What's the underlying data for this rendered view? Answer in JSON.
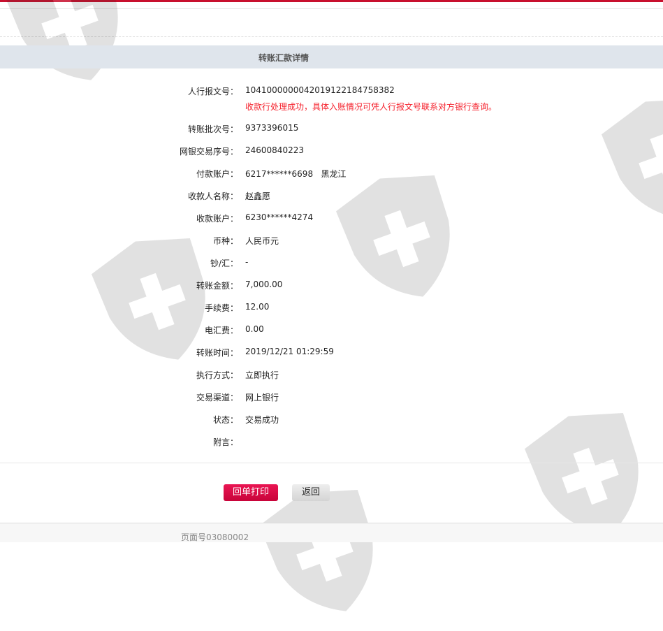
{
  "title": "转账汇款详情",
  "rows": [
    {
      "label": "人行报文号：",
      "value": "1041000000042019122184758382",
      "note": "收款行处理成功，具体入账情况可凭人行报文号联系对方银行查询。"
    },
    {
      "label": "转账批次号：",
      "value": "9373396015"
    },
    {
      "label": "网银交易序号：",
      "value": "24600840223"
    },
    {
      "label": "付款账户：",
      "value": "6217******6698   黑龙江"
    },
    {
      "label": "收款人名称：",
      "value": "赵鑫愿"
    },
    {
      "label": "收款账户：",
      "value": "6230******4274"
    },
    {
      "label": "币种：",
      "value": "人民币元"
    },
    {
      "label": "钞/汇：",
      "value": "-"
    },
    {
      "label": "转账金额：",
      "value": "7,000.00"
    },
    {
      "label": "手续费：",
      "value": "12.00"
    },
    {
      "label": "电汇费：",
      "value": "0.00"
    },
    {
      "label": "转账时间：",
      "value": "2019/12/21 01:29:59"
    },
    {
      "label": "执行方式：",
      "value": "立即执行"
    },
    {
      "label": "交易渠道：",
      "value": "网上银行"
    },
    {
      "label": "状态：",
      "value": "交易成功"
    },
    {
      "label": "附言：",
      "value": ""
    }
  ],
  "buttons": {
    "print": "回单打印",
    "back": "返回"
  },
  "footer": {
    "page_no": "页面号03080002"
  },
  "colors": {
    "accent": "#c8102e",
    "note": "#f5222d"
  }
}
